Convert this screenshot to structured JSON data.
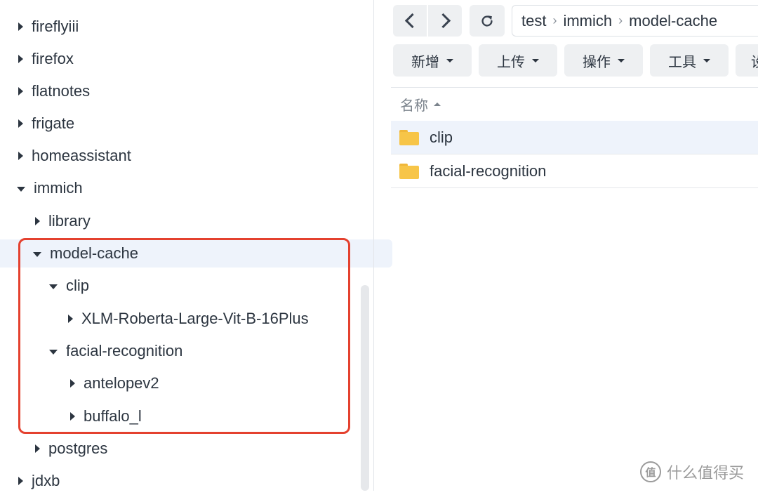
{
  "tree": {
    "items": [
      {
        "label": "fireflyiii",
        "expanded": false
      },
      {
        "label": "firefox",
        "expanded": false
      },
      {
        "label": "flatnotes",
        "expanded": false
      },
      {
        "label": "frigate",
        "expanded": false
      },
      {
        "label": "homeassistant",
        "expanded": false
      },
      {
        "label": "immich",
        "expanded": true
      },
      {
        "label": "library",
        "expanded": false
      },
      {
        "label": "model-cache",
        "expanded": true,
        "selected": true
      },
      {
        "label": "clip",
        "expanded": true
      },
      {
        "label": "XLM-Roberta-Large-Vit-B-16Plus",
        "expanded": false
      },
      {
        "label": "facial-recognition",
        "expanded": true
      },
      {
        "label": "antelopev2",
        "expanded": false
      },
      {
        "label": "buffalo_l",
        "expanded": false
      },
      {
        "label": "postgres",
        "expanded": false
      },
      {
        "label": "jdxb",
        "expanded": false
      }
    ]
  },
  "breadcrumb": [
    "test",
    "immich",
    "model-cache"
  ],
  "toolbar": {
    "create": "新增",
    "upload": "上传",
    "action": "操作",
    "tools": "工具",
    "partial": "设"
  },
  "list": {
    "column_name": "名称",
    "rows": [
      {
        "name": "clip",
        "selected": true
      },
      {
        "name": "facial-recognition",
        "selected": false
      }
    ]
  },
  "watermark": {
    "icon_text": "值",
    "text": "什么值得买"
  },
  "colors": {
    "highlight_border": "#e4412f",
    "selected_row": "#eef3fb",
    "folder": "#f7c548",
    "button_bg": "#eef0f2"
  }
}
